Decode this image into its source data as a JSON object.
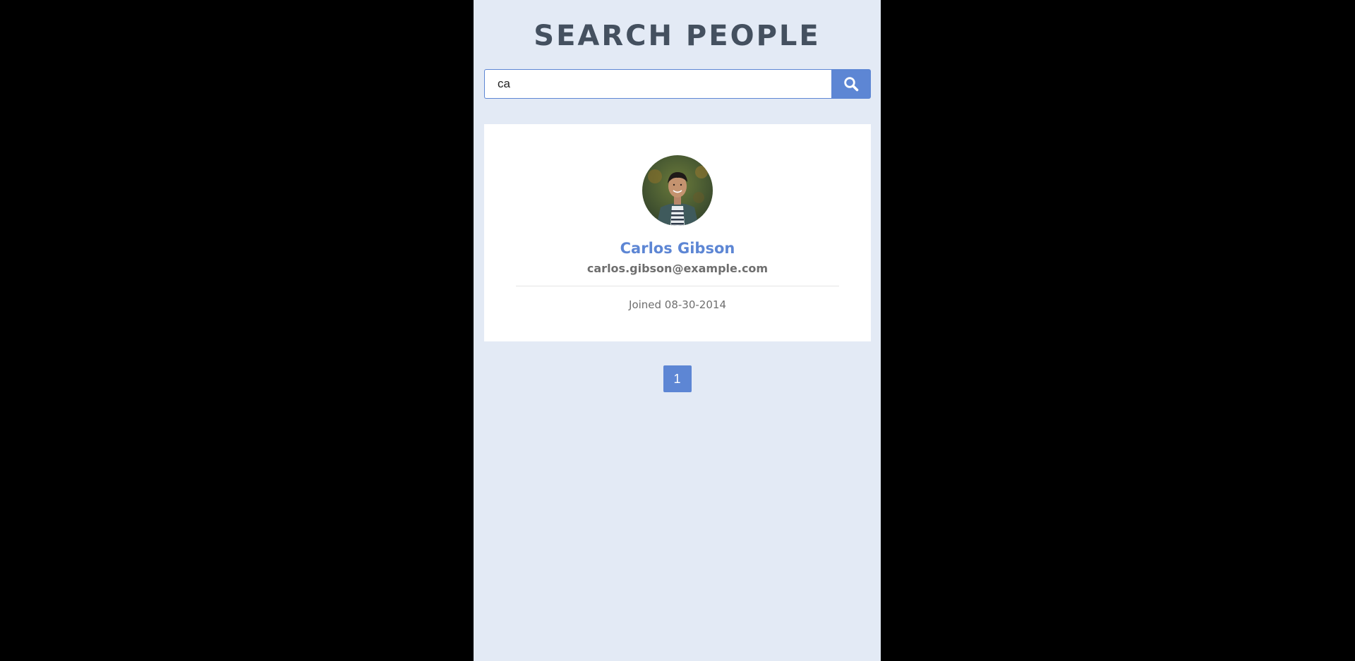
{
  "header": {
    "title": "SEARCH PEOPLE"
  },
  "search": {
    "value": "ca",
    "button_icon": "search-icon"
  },
  "results": [
    {
      "avatar": "person-avatar-photo",
      "name": "Carlos Gibson",
      "email": "carlos.gibson@example.com",
      "joined": "Joined 08-30-2014"
    }
  ],
  "pagination": {
    "pages": [
      "1"
    ],
    "current": "1"
  },
  "colors": {
    "accent": "#5d86d4",
    "page_background": "#e3eaf5",
    "title": "#44505f",
    "outer_background": "#000000"
  }
}
